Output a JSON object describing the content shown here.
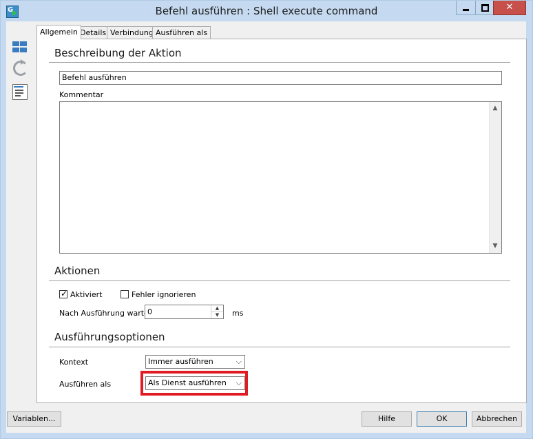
{
  "window": {
    "title": "Befehl ausführen : Shell execute command",
    "app_icon_letter": "G",
    "close_glyph": "✕"
  },
  "sidebar": {
    "icons": [
      "grid-icon",
      "refresh-icon",
      "list-icon"
    ]
  },
  "tabs": [
    {
      "label": "Allgemein",
      "active": true
    },
    {
      "label": "Details",
      "active": false
    },
    {
      "label": "Verbindung",
      "active": false
    },
    {
      "label": "Ausführen als",
      "active": false
    }
  ],
  "description": {
    "section_title": "Beschreibung der Aktion",
    "name_value": "Befehl ausführen",
    "comment_label": "Kommentar",
    "comment_value": "",
    "scroll_up": "▲",
    "scroll_down": "▼"
  },
  "actions": {
    "section_title": "Aktionen",
    "activated_label": "Aktiviert",
    "activated_checked": true,
    "check_glyph": "✓",
    "ignore_errors_label": "Fehler ignorieren",
    "ignore_errors_checked": false,
    "wait_label": "Nach Ausführung warten",
    "wait_value": "0",
    "wait_unit": "ms",
    "spin_up": "▲",
    "spin_down": "▼"
  },
  "options": {
    "section_title": "Ausführungsoptionen",
    "context_label": "Kontext",
    "context_value": "Immer ausführen",
    "run_as_label": "Ausführen als",
    "run_as_value": "Als Dienst ausführen",
    "dropdown_glyph": "⌵",
    "highlight_color": "#e01b24"
  },
  "footer": {
    "variables_label": "Variablen...",
    "help_label": "Hilfe",
    "ok_label": "OK",
    "cancel_label": "Abbrechen"
  }
}
